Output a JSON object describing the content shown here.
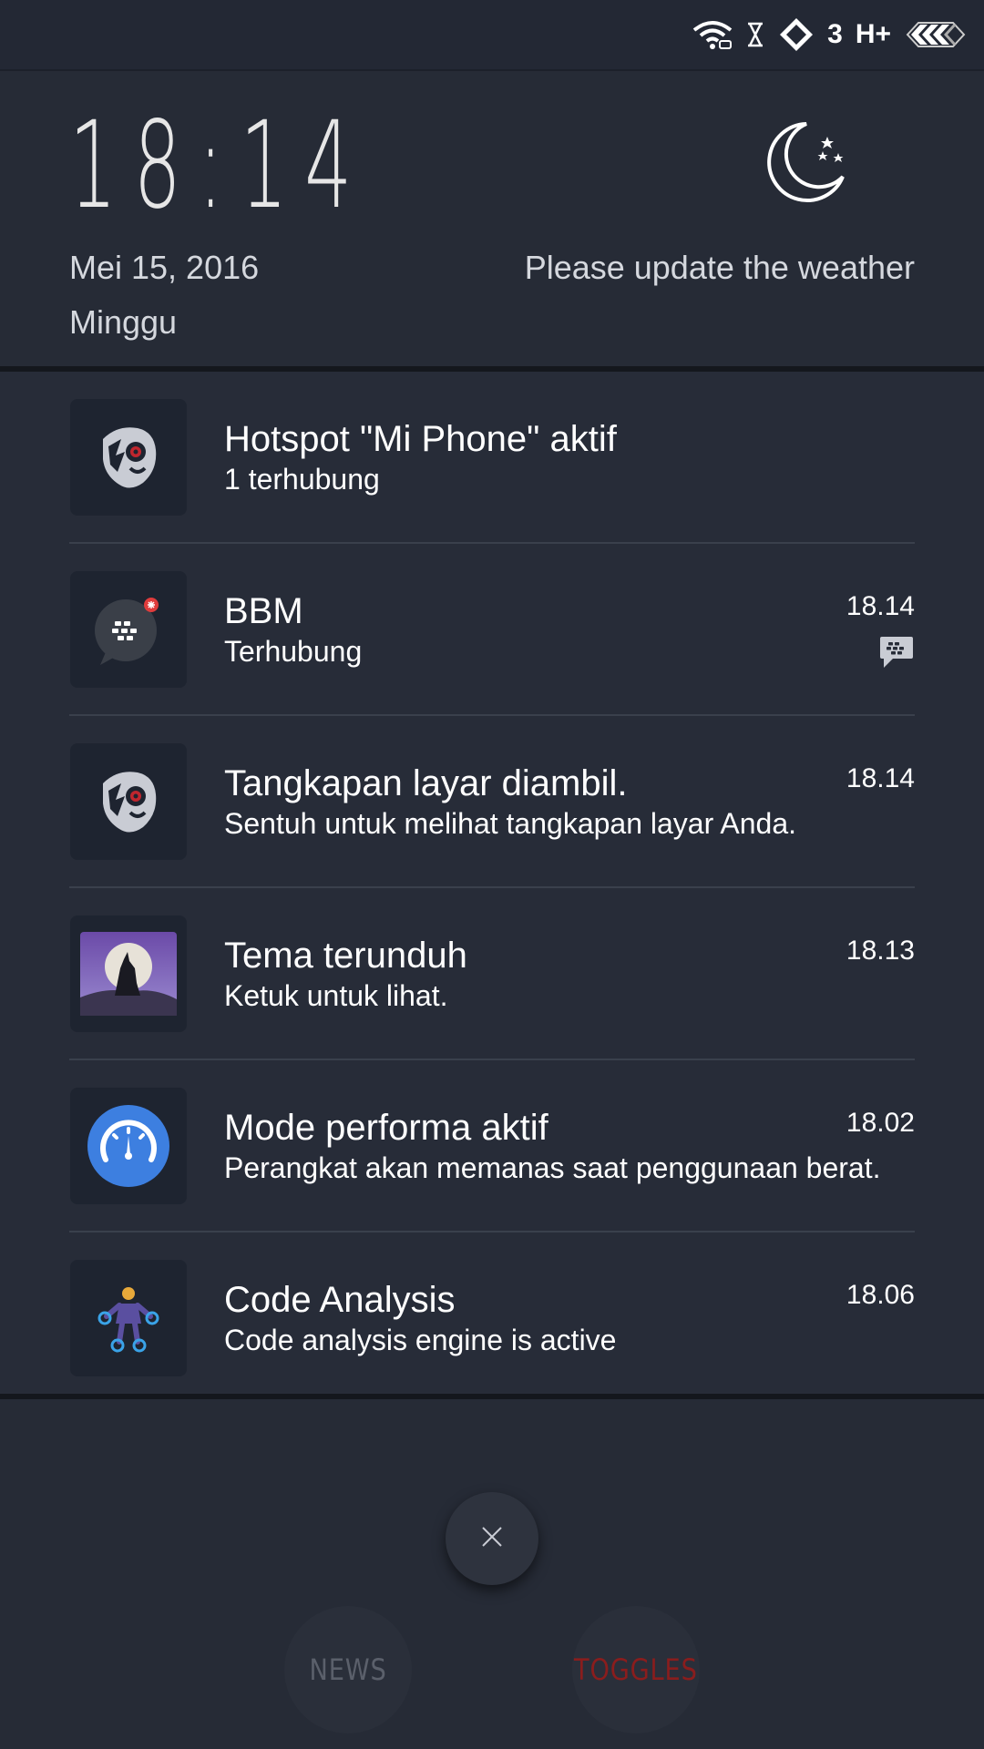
{
  "status_bar": {
    "network_label": "3",
    "network_type": "H+",
    "icons": [
      "wifi-icon",
      "hourglass-icon",
      "diamond-icon",
      "battery-icon"
    ]
  },
  "header": {
    "time": "18:14",
    "date": "Mei  15, 2016",
    "day": "Minggu",
    "weather_message": "Please update the weather",
    "weather_icon": "moon-stars-icon"
  },
  "notifications": [
    {
      "app_icon": "mask-icon",
      "title": "Hotspot \"Mi Phone\" aktif",
      "subtitle": "1 terhubung",
      "time": ""
    },
    {
      "app_icon": "bbm-icon",
      "title": "BBM",
      "subtitle": "Terhubung",
      "time": "18.14",
      "small_icon": "bbm-small-icon"
    },
    {
      "app_icon": "mask-icon",
      "title": "Tangkapan layar diambil.",
      "subtitle": "Sentuh untuk melihat tangkapan layar Anda.",
      "time": "18.14"
    },
    {
      "app_icon": "wolf-theme-icon",
      "title": "Tema terunduh",
      "subtitle": "Ketuk untuk lihat.",
      "time": "18.13"
    },
    {
      "app_icon": "speedometer-icon",
      "title": "Mode performa aktif",
      "subtitle": "Perangkat akan memanas saat penggunaan berat.",
      "time": "18.02"
    },
    {
      "app_icon": "person-analysis-icon",
      "title": "Code Analysis",
      "subtitle": "Code analysis engine is active",
      "time": "18.06"
    }
  ],
  "controls": {
    "news_label": "NEWS",
    "toggles_label": "TOGGLES"
  },
  "colors": {
    "background": "#262b36",
    "panel": "#272c38",
    "toggles_red": "#8a1d1d",
    "speedometer_blue": "#3d7fe0"
  }
}
